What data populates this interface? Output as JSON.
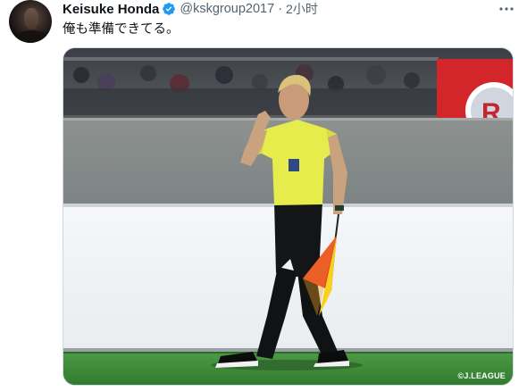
{
  "tweet": {
    "author": {
      "name": "Keisuke Honda",
      "handle": "@kskgroup2017",
      "verified": true,
      "avatar": "avatar"
    },
    "separator": "·",
    "time": "2小时",
    "text": "俺も準備できてる。",
    "media": {
      "credit": "©J.LEAGUE"
    },
    "more_icon": "more-horizontal-icon"
  },
  "colors": {
    "verified": "#1d9bf0",
    "secondary_text": "#536471",
    "border": "#cfd9de",
    "jersey": "#e6ec4c",
    "flag_red": "#e8362a",
    "flag_yellow": "#f5d31c",
    "pitch": "#3f8a3a"
  }
}
